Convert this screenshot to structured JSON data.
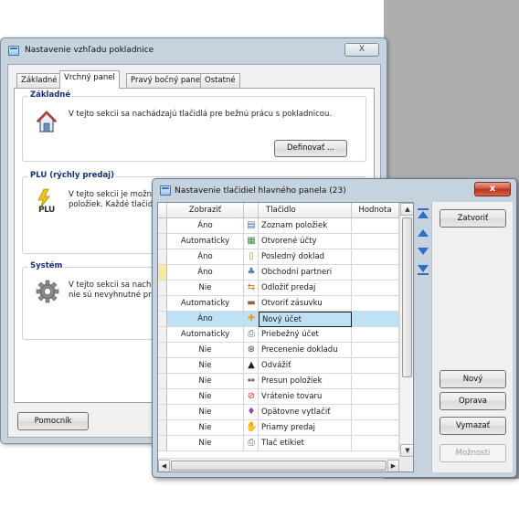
{
  "main_window": {
    "title": "Nastavenie vzhľadu pokladnice",
    "close_label": "X",
    "tabs": [
      {
        "label": "Základné"
      },
      {
        "label": "Vrchný panel"
      },
      {
        "label": "Pravý bočný panel"
      },
      {
        "label": "Ostatné"
      }
    ],
    "active_tab": "Vrchný panel",
    "groups": {
      "basic": {
        "title": "Základné",
        "text": "V tejto sekcii sa nachádzajú tlačidlá pre bežnú prácu s pokladnicou.",
        "button": "Definovať ..."
      },
      "plu": {
        "title": "PLU (rýchly predaj)",
        "text_line1": "V tejto sekcii je možn",
        "text_line2": "položiek. Každé tlačid",
        "icon_label": "PLU"
      },
      "system": {
        "title": "Systém",
        "text_line1": "V tejto sekcii sa nach",
        "text_line2": "nie sú nevyhnutné pr"
      }
    },
    "help_button": "Pomocník"
  },
  "sub_window": {
    "title": "Nastavenie tlačidiel hlavného panela (23)",
    "close_label": "x",
    "columns": {
      "zobrazit": "Zobraziť",
      "tlacidlo": "Tlačidlo",
      "hodnota": "Hodnota"
    },
    "rows": [
      {
        "zobrazit": "Áno",
        "tlacidlo": "Zoznam položiek",
        "icon": "list-icon",
        "glyph": "▤",
        "color": "#4a6fa5"
      },
      {
        "zobrazit": "Automaticky",
        "tlacidlo": "Otvorené účty",
        "icon": "grid-icon",
        "glyph": "▦",
        "color": "#3c8b3c"
      },
      {
        "zobrazit": "Áno",
        "tlacidlo": "Posledný doklad",
        "icon": "document-icon",
        "glyph": "▯",
        "color": "#c0a020"
      },
      {
        "zobrazit": "Áno",
        "tlacidlo": "Obchodní partneri",
        "icon": "partners-icon",
        "glyph": "♣",
        "color": "#5a7aa8"
      },
      {
        "zobrazit": "Nie",
        "tlacidlo": "Odložiť predaj",
        "icon": "defer-icon",
        "glyph": "⇆",
        "color": "#b07a20"
      },
      {
        "zobrazit": "Automaticky",
        "tlacidlo": "Otvoriť zásuvku",
        "icon": "drawer-icon",
        "glyph": "▬",
        "color": "#8a6a3a"
      },
      {
        "zobrazit": "Áno",
        "tlacidlo": "Nový účet",
        "icon": "new-bill-icon",
        "glyph": "✚",
        "color": "#e0a020"
      },
      {
        "zobrazit": "Automaticky",
        "tlacidlo": "Priebežný účet",
        "icon": "printer-icon",
        "glyph": "⎙",
        "color": "#5c6c80"
      },
      {
        "zobrazit": "Nie",
        "tlacidlo": "Precenenie dokladu",
        "icon": "reprice-icon",
        "glyph": "⊛",
        "color": "#3a3a3a"
      },
      {
        "zobrazit": "Nie",
        "tlacidlo": "Odvážiť",
        "icon": "weight-icon",
        "glyph": "▲",
        "color": "#222222"
      },
      {
        "zobrazit": "Nie",
        "tlacidlo": "Presun položiek",
        "icon": "move-icon",
        "glyph": "⇔",
        "color": "#333333"
      },
      {
        "zobrazit": "Nie",
        "tlacidlo": "Vrátenie tovaru",
        "icon": "return-icon",
        "glyph": "⊘",
        "color": "#d03020"
      },
      {
        "zobrazit": "Nie",
        "tlacidlo": "Opätovne vytlačiť",
        "icon": "reprint-icon",
        "glyph": "♦",
        "color": "#9a40a0"
      },
      {
        "zobrazit": "Nie",
        "tlacidlo": "Priamy predaj",
        "icon": "hand-icon",
        "glyph": "✋",
        "color": "#d09020"
      },
      {
        "zobrazit": "Nie",
        "tlacidlo": "Tlač etikiet",
        "icon": "label-print-icon",
        "glyph": "⎙",
        "color": "#5c6c80"
      }
    ],
    "selected_row": 6,
    "buttons": {
      "close": "Zatvoriť",
      "new": "Nový",
      "edit": "Oprava",
      "delete": "Vymazať",
      "options": "Možnosti"
    }
  }
}
